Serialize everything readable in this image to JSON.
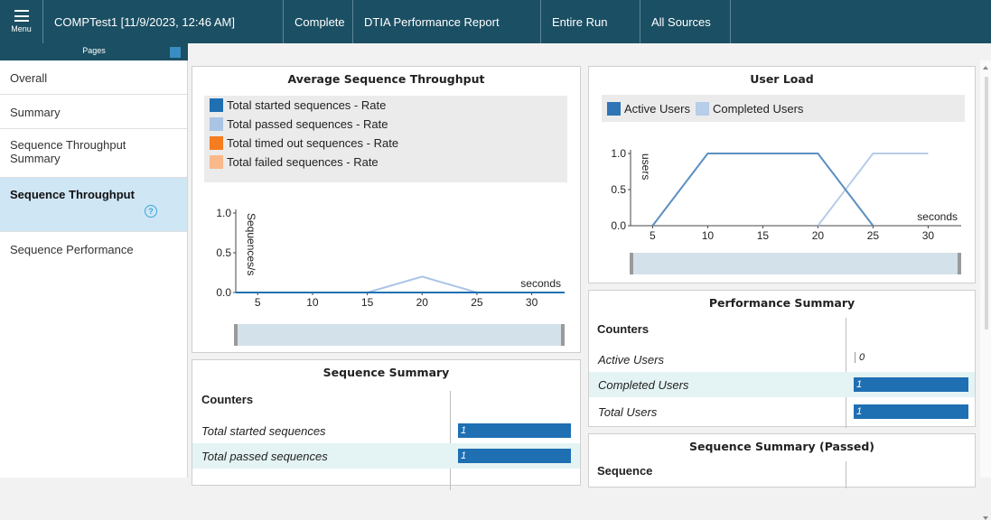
{
  "topbar": {
    "menu_label": "Menu",
    "items": [
      "COMPTest1 [11/9/2023, 12:46 AM]",
      "Complete",
      "DTIA Performance Report",
      "Entire Run",
      "All Sources"
    ]
  },
  "pages": {
    "header": "Pages",
    "items": [
      {
        "label": "Overall"
      },
      {
        "label": "Summary"
      },
      {
        "label": "Sequence Throughput Summary"
      },
      {
        "label": "Sequence Throughput"
      },
      {
        "label": "Sequence Performance"
      }
    ],
    "active_index": 3
  },
  "throughput_chart": {
    "title": "Average Sequence Throughput",
    "legend": [
      {
        "label": "Total started sequences - Rate",
        "color": "#1f6fb3"
      },
      {
        "label": "Total passed sequences - Rate",
        "color": "#aac4e4"
      },
      {
        "label": "Total timed out sequences - Rate",
        "color": "#f57c1f"
      },
      {
        "label": "Total failed sequences - Rate",
        "color": "#f9b98a"
      }
    ]
  },
  "user_load_chart": {
    "title": "User Load",
    "legend": [
      {
        "label": "Active Users",
        "color": "#2f74b5"
      },
      {
        "label": "Completed Users",
        "color": "#b7cde8"
      }
    ]
  },
  "chart_data": [
    {
      "type": "line",
      "title": "Average Sequence Throughput",
      "xlabel": "seconds",
      "ylabel": "Sequences/s",
      "xticks": [
        5,
        10,
        15,
        20,
        25,
        30
      ],
      "yticks": [
        "0.0",
        "0.5",
        "1.0"
      ],
      "xlim": [
        3,
        33
      ],
      "ylim": [
        0,
        1
      ],
      "x": [
        3,
        5,
        10,
        15,
        20,
        25,
        30,
        33
      ],
      "series": [
        {
          "name": "Total started sequences - Rate",
          "color": "#1f6fb3",
          "values": [
            0,
            0,
            0,
            0,
            0,
            0,
            0,
            0
          ]
        },
        {
          "name": "Total passed sequences - Rate",
          "color": "#aac4e4",
          "values": [
            0,
            0,
            0,
            0,
            0.2,
            0,
            0,
            0
          ]
        },
        {
          "name": "Total timed out sequences - Rate",
          "color": "#f57c1f",
          "values": [
            0,
            0,
            0,
            0,
            0,
            0,
            0,
            0
          ]
        },
        {
          "name": "Total failed sequences - Rate",
          "color": "#f9b98a",
          "values": [
            0,
            0,
            0,
            0,
            0,
            0,
            0,
            0
          ]
        }
      ]
    },
    {
      "type": "line",
      "title": "User Load",
      "xlabel": "seconds",
      "ylabel": "users",
      "xticks": [
        5,
        10,
        15,
        20,
        25,
        30
      ],
      "yticks": [
        "0.0",
        "0.5",
        "1.0"
      ],
      "xlim": [
        3,
        33
      ],
      "ylim": [
        0,
        1
      ],
      "series": [
        {
          "name": "Active Users",
          "color": "#5b8fbf",
          "x": [
            5,
            10,
            20,
            25
          ],
          "values": [
            0,
            1,
            1,
            0
          ]
        },
        {
          "name": "Completed Users",
          "color": "#b7cde8",
          "x": [
            20,
            25,
            30
          ],
          "values": [
            0,
            1,
            1
          ]
        }
      ]
    }
  ],
  "sequence_summary": {
    "title": "Sequence Summary",
    "header": "Counters",
    "rows": [
      {
        "label": "Total started sequences",
        "value": "1"
      },
      {
        "label": "Total passed sequences",
        "value": "1"
      }
    ]
  },
  "performance_summary": {
    "title": "Performance Summary",
    "header": "Counters",
    "rows": [
      {
        "label": "Active Users",
        "value": "0"
      },
      {
        "label": "Completed Users",
        "value": "1"
      },
      {
        "label": "Total Users",
        "value": "1"
      }
    ]
  },
  "sequence_summary_passed": {
    "title": "Sequence Summary (Passed)",
    "header": "Sequence"
  }
}
